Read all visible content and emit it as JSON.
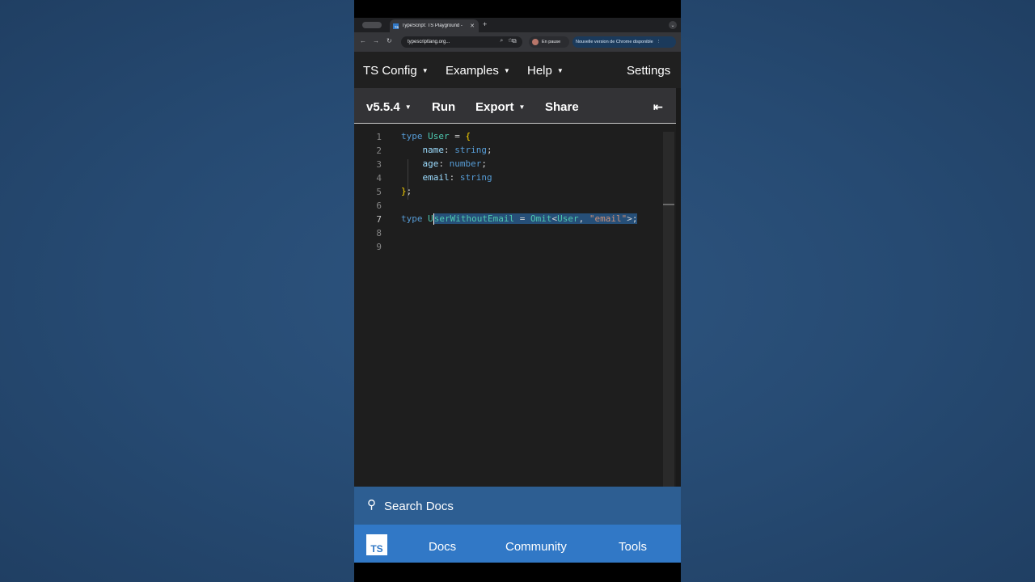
{
  "browser": {
    "tab_title": "TypeScript: TS Playground -",
    "tab_favicon": "TS",
    "url": "typescriptlang.org...",
    "profile_status": "En pause",
    "update_notice": "Nouvelle version de Chrome disponible"
  },
  "ts_nav": {
    "ts_config": "TS Config",
    "examples": "Examples",
    "help": "Help",
    "settings": "Settings"
  },
  "toolbar": {
    "version": "v5.5.4",
    "run": "Run",
    "export": "Export",
    "share": "Share"
  },
  "editor": {
    "line_numbers": [
      "1",
      "2",
      "3",
      "4",
      "5",
      "6",
      "7",
      "8",
      "9"
    ],
    "active_line": 7,
    "code": {
      "l1_kw": "type",
      "l1_name": "User",
      "l1_eq": " = ",
      "l1_brace": "{",
      "l2_prop": "name",
      "l2_type": "string",
      "l3_prop": "age",
      "l3_type": "number",
      "l4_prop": "email",
      "l4_type": "string",
      "l5_brace": "}",
      "l7_kw": "type",
      "l7_u": "U",
      "l7_name_rest": "serWithoutEmail",
      "l7_eq": " = ",
      "l7_omit": "Omit",
      "l7_lt": "<",
      "l7_user": "User",
      "l7_comma": ", ",
      "l7_str": "\"email\"",
      "l7_end": ">;"
    }
  },
  "bottom": {
    "search": "Search Docs",
    "logo": "TS",
    "docs": "Docs",
    "community": "Community",
    "tools": "Tools"
  },
  "colors": {
    "keyword": "#569cd6",
    "type_name": "#4ec9b0",
    "property": "#9cdcfe",
    "string": "#ce9178",
    "selection": "#264f78",
    "brand_blue": "#3178c6"
  }
}
